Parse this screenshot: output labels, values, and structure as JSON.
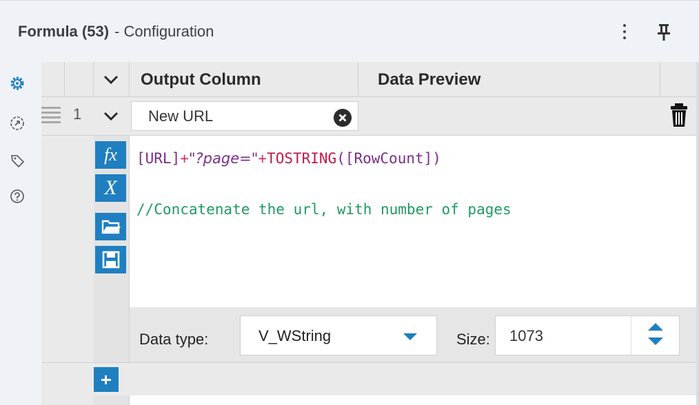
{
  "header": {
    "tool_title": "Formula (53)",
    "subtitle": "- Configuration"
  },
  "grid": {
    "col_output": "Output Column",
    "col_preview": "Data Preview"
  },
  "row": {
    "number": "1",
    "name_value": "New URL"
  },
  "expression": {
    "bracket_field_url": "[URL]",
    "op_plus_1": "+",
    "string_literal": "\"?page=\"",
    "op_plus_2": "+",
    "function_name": "TOSTRING",
    "function_args": "([RowCount])",
    "comment": "//Concatenate the url, with number of pages"
  },
  "datatype": {
    "label": "Data type:",
    "value": "V_WString",
    "size_label": "Size:",
    "size_value": "1073"
  },
  "icons": {
    "rail": [
      "gear-icon",
      "results-icon",
      "tag-icon",
      "help-icon"
    ],
    "tools": [
      "function-icon",
      "variable-icon",
      "open-icon",
      "save-icon"
    ]
  },
  "colors": {
    "accent": "#1f7fc0",
    "comment": "#1f9a60",
    "field": "#7a2d8a",
    "function": "#c2184a"
  }
}
